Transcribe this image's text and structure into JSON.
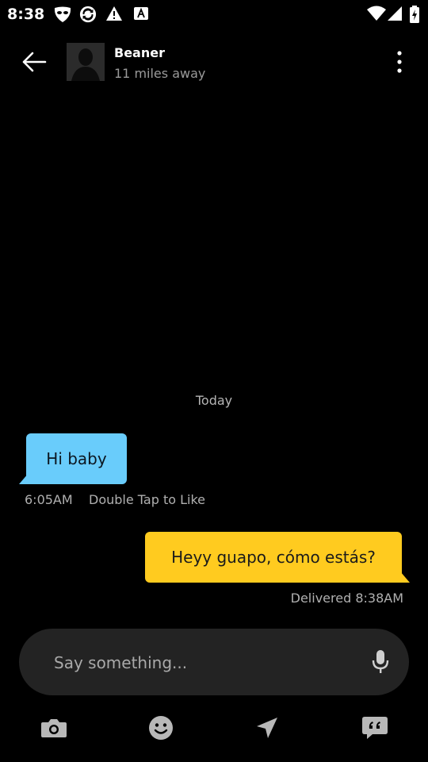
{
  "status_bar": {
    "time": "8:38",
    "icons": [
      "grindr-mask-icon",
      "sync-icon",
      "warning-icon",
      "app-icon",
      "wifi-icon",
      "signal-icon",
      "battery-icon"
    ]
  },
  "header": {
    "name": "Beaner",
    "distance": "11 miles away",
    "icons": [
      "back-arrow-icon",
      "avatar-placeholder",
      "more-vert-icon"
    ]
  },
  "conversation": {
    "date_separator": "Today",
    "messages": [
      {
        "direction": "incoming",
        "text": "Hi baby",
        "time": "6:05AM",
        "hint": "Double Tap to Like",
        "bubble_color": "#69ccfb"
      },
      {
        "direction": "outgoing",
        "text": "Heyy guapo, cómo estás?",
        "status": "Delivered 8:38AM",
        "bubble_color": "#ffcb1f"
      }
    ]
  },
  "composer": {
    "placeholder": "Say something...",
    "value": ""
  },
  "toolbar": {
    "items": [
      "camera-icon",
      "emoji-icon",
      "location-icon",
      "saved-phrases-icon"
    ]
  },
  "colors": {
    "background": "#000000",
    "incoming_bubble": "#69ccfb",
    "outgoing_bubble": "#ffcb1f",
    "composer_bg": "#232323",
    "icon_gray": "#b8b8b8"
  }
}
